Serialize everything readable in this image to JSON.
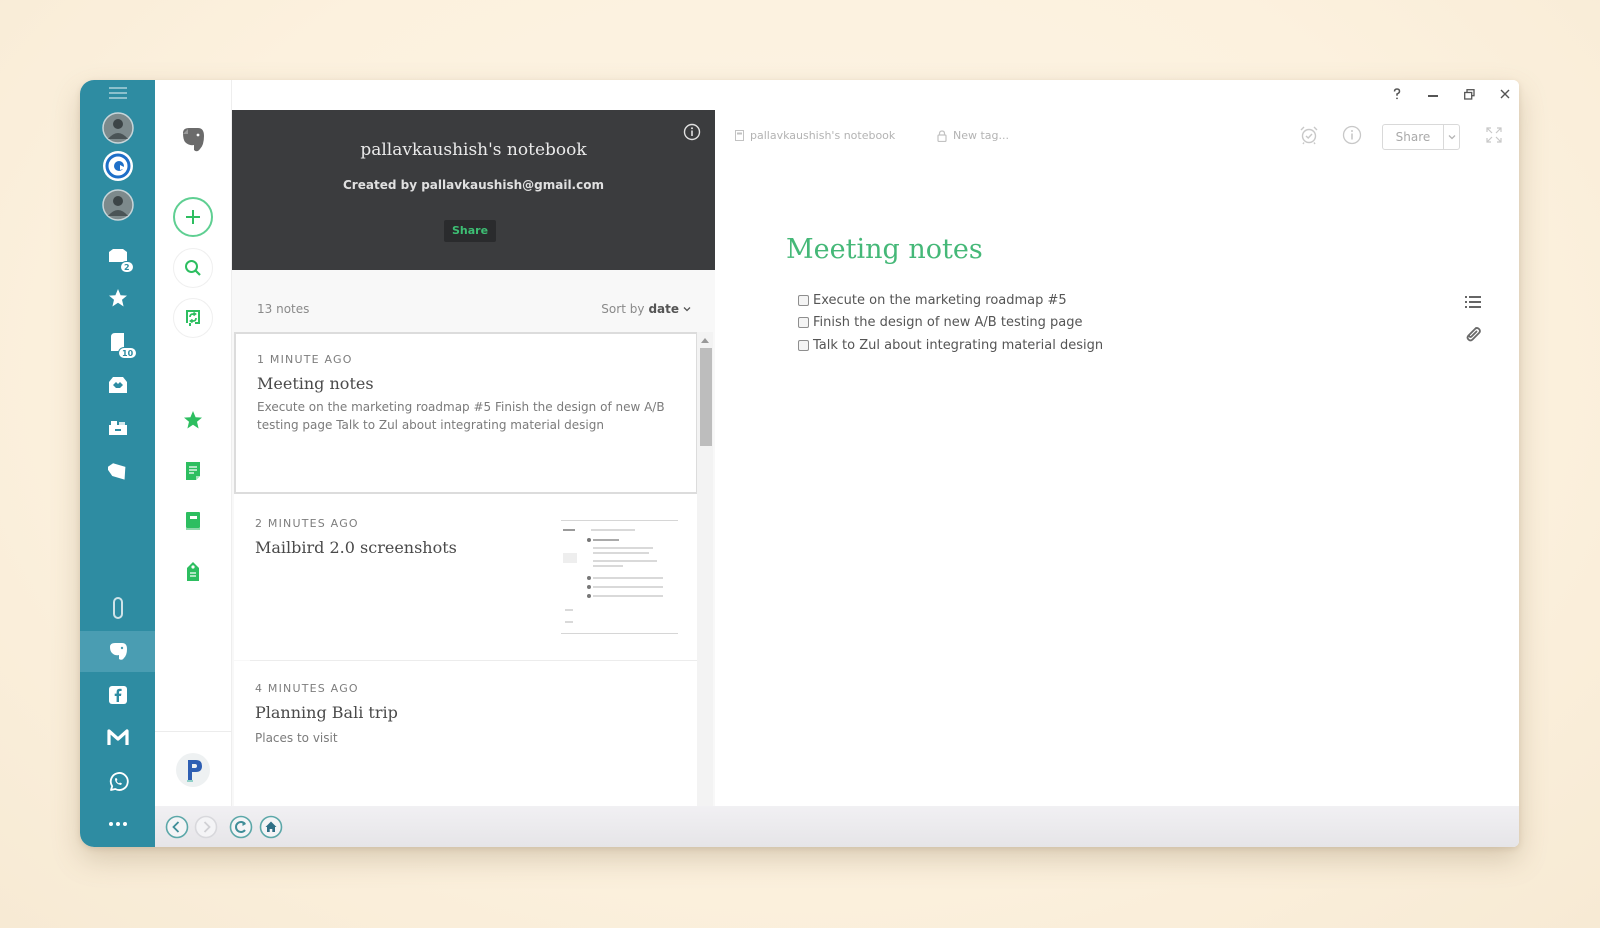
{
  "colors": {
    "accounts_sidebar": "#2e8ca2",
    "accent_green": "#2dbe60",
    "note_title_green": "#45b878",
    "notebook_header": "#3b3c3e",
    "background": "#fcf1de"
  },
  "accounts_sidebar": {
    "items": [
      {
        "name": "menu",
        "icon": "hamburger-icon"
      },
      {
        "name": "account-1",
        "icon": "avatar-photo"
      },
      {
        "name": "mailbird",
        "icon": "mailbird-logo-icon"
      },
      {
        "name": "account-2",
        "icon": "avatar-photo"
      },
      {
        "name": "unified-inbox",
        "icon": "inbox-icon",
        "badge": "2"
      },
      {
        "name": "starred",
        "icon": "star-icon"
      },
      {
        "name": "drafts",
        "icon": "drafts-icon",
        "badge": "10"
      },
      {
        "name": "inbox-tray",
        "icon": "inbox-tray-icon"
      },
      {
        "name": "archive",
        "icon": "archive-icon"
      },
      {
        "name": "tags",
        "icon": "tag-icon"
      },
      {
        "name": "attachments",
        "icon": "paperclip-icon"
      },
      {
        "name": "evernote",
        "icon": "evernote-icon",
        "active": true
      },
      {
        "name": "facebook",
        "icon": "facebook-icon"
      },
      {
        "name": "gmail",
        "icon": "gmail-icon"
      },
      {
        "name": "whatsapp",
        "icon": "whatsapp-icon"
      },
      {
        "name": "more",
        "icon": "more-dots-icon"
      }
    ]
  },
  "evernote_nav": {
    "items": [
      "evernote-logo",
      "new-note",
      "search",
      "sync",
      "shortcuts",
      "notes",
      "notebooks",
      "tags",
      "account-avatar"
    ]
  },
  "notebook": {
    "title": "pallavkaushish's notebook",
    "created_by": "Created by pallavkaushish@gmail.com",
    "share_label": "Share"
  },
  "note_list": {
    "count": "13 notes",
    "sort_prefix": "Sort by",
    "sort_value": "date",
    "notes": [
      {
        "time": "1 minute ago",
        "title": "Meeting notes",
        "preview": "Execute on the marketing roadmap #5 Finish the design of new A/B testing page Talk to Zul about integrating material design",
        "selected": true
      },
      {
        "time": "2 minutes ago",
        "title": "Mailbird 2.0 screenshots",
        "preview": "",
        "has_thumbnail": true
      },
      {
        "time": "4 minutes ago",
        "title": "Planning Bali trip",
        "preview": "Places to visit"
      }
    ]
  },
  "editor": {
    "notebook": "pallavkaushish's notebook",
    "tag_placeholder": "New tag...",
    "share_label": "Share",
    "title": "Meeting notes",
    "checklist": [
      {
        "text": "Execute on the marketing roadmap #5",
        "checked": false
      },
      {
        "text": "Finish the design of new A/B testing page",
        "checked": false
      },
      {
        "text": "Talk to Zul about integrating material design",
        "checked": false
      }
    ]
  }
}
